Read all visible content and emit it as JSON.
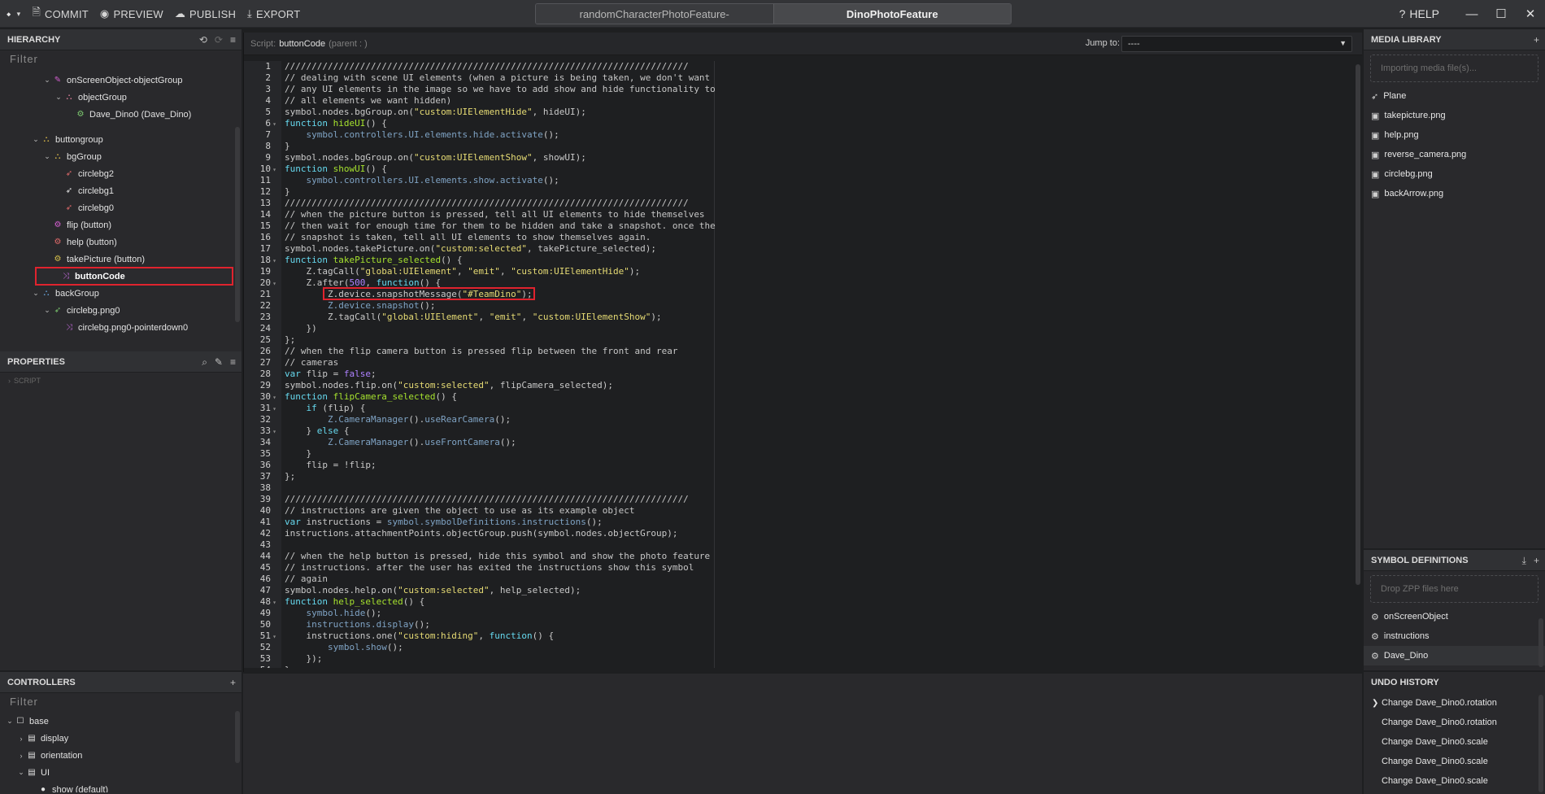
{
  "topbar": {
    "commit": "COMMIT",
    "preview": "PREVIEW",
    "publish": "PUBLISH",
    "export": "EXPORT",
    "help": "HELP",
    "tabs": [
      "randomCharacterPhotoFeature-",
      "DinoPhotoFeature"
    ],
    "active_tab_index": 1
  },
  "hierarchy": {
    "title": "HIERARCHY",
    "filter_placeholder": "Filter",
    "rows": [
      {
        "label": "onScreenObject-objectGroup",
        "level": 2,
        "caret": "open",
        "icon": "link",
        "color": "#d45fd0"
      },
      {
        "label": "objectGroup",
        "level": 3,
        "caret": "open",
        "icon": "group",
        "color": "#e2809e"
      },
      {
        "label": "Dave_Dino0 (Dave_Dino)",
        "level": 4,
        "caret": "",
        "icon": "gear",
        "color": "#7cc86f"
      },
      {
        "label": "",
        "level": 0,
        "caret": "",
        "icon": "",
        "color": ""
      },
      {
        "label": "buttongroup",
        "level": 1,
        "caret": "open",
        "icon": "group",
        "color": "#e3c14c"
      },
      {
        "label": "bgGroup",
        "level": 2,
        "caret": "open",
        "icon": "group",
        "color": "#e3c14c"
      },
      {
        "label": "circlebg2",
        "level": 3,
        "caret": "",
        "icon": "rocket",
        "color": "#e06a6a"
      },
      {
        "label": "circlebg1",
        "level": 3,
        "caret": "",
        "icon": "rocket",
        "color": "#e6e6e6"
      },
      {
        "label": "circlebg0",
        "level": 3,
        "caret": "",
        "icon": "rocket",
        "color": "#e06a6a"
      },
      {
        "label": "flip (button)",
        "level": 2,
        "caret": "",
        "icon": "gear",
        "color": "#d45fd0"
      },
      {
        "label": "help (button)",
        "level": 2,
        "caret": "",
        "icon": "gear",
        "color": "#e06a6a"
      },
      {
        "label": "takePicture (button)",
        "level": 2,
        "caret": "",
        "icon": "gear",
        "color": "#d7c04a"
      },
      {
        "label": "buttonCode",
        "level": 2,
        "caret": "",
        "icon": "script",
        "color": "#c06ad8",
        "selected": true
      },
      {
        "label": "backGroup",
        "level": 1,
        "caret": "open",
        "icon": "group",
        "color": "#6aa8e0"
      },
      {
        "label": "circlebg.png0",
        "level": 2,
        "caret": "open",
        "icon": "rocket",
        "color": "#7cc86f"
      },
      {
        "label": "circlebg.png0-pointerdown0",
        "level": 3,
        "caret": "",
        "icon": "script",
        "color": "#c06ad8"
      }
    ]
  },
  "properties": {
    "title": "PROPERTIES",
    "section": "SCRIPT"
  },
  "controllers": {
    "title": "CONTROLLERS",
    "filter_placeholder": "Filter",
    "rows": [
      {
        "label": "base",
        "level": 0,
        "caret": "open",
        "icon": "square"
      },
      {
        "label": "display",
        "level": 1,
        "caret": "closed",
        "icon": "list"
      },
      {
        "label": "orientation",
        "level": 1,
        "caret": "closed",
        "icon": "list"
      },
      {
        "label": "UI",
        "level": 1,
        "caret": "open",
        "icon": "list"
      },
      {
        "label": "show (default)",
        "level": 2,
        "caret": "",
        "icon": "dot"
      }
    ]
  },
  "editor": {
    "script_label": "Script:",
    "script_name": "buttonCode",
    "script_parent": "(parent : )",
    "jump_label": "Jump to:",
    "jump_value": "----",
    "lines": [
      [
        [
          "c",
          "///////////////////////////////////////////////////////////////////////////"
        ]
      ],
      [
        [
          "c",
          "// dealing with scene UI elements (when a picture is being taken, we don't want"
        ]
      ],
      [
        [
          "c",
          "// any UI elements in the image so we have to add show and hide functionality to"
        ]
      ],
      [
        [
          "c",
          "// all elements we want hidden)"
        ]
      ],
      [
        [
          "t",
          "symbol.nodes.bgGroup.on("
        ],
        [
          "s",
          "\"custom:UIElementHide\""
        ],
        [
          "t",
          ", hideUI);"
        ]
      ],
      [
        [
          "k",
          "function"
        ],
        [
          "t",
          " "
        ],
        [
          "f",
          "hideUI"
        ],
        [
          "t",
          "() {"
        ]
      ],
      [
        [
          "t",
          "    "
        ],
        [
          "d",
          "symbol.controllers.UI.elements.hide.activate"
        ],
        [
          "t",
          "();"
        ]
      ],
      [
        [
          "t",
          "}"
        ]
      ],
      [
        [
          "t",
          "symbol.nodes.bgGroup.on("
        ],
        [
          "s",
          "\"custom:UIElementShow\""
        ],
        [
          "t",
          ", showUI);"
        ]
      ],
      [
        [
          "k",
          "function"
        ],
        [
          "t",
          " "
        ],
        [
          "f",
          "showUI"
        ],
        [
          "t",
          "() {"
        ]
      ],
      [
        [
          "t",
          "    "
        ],
        [
          "d",
          "symbol.controllers.UI.elements.show.activate"
        ],
        [
          "t",
          "();"
        ]
      ],
      [
        [
          "t",
          "}"
        ]
      ],
      [
        [
          "c",
          "///////////////////////////////////////////////////////////////////////////"
        ]
      ],
      [
        [
          "c",
          "// when the picture button is pressed, tell all UI elements to hide themselves"
        ]
      ],
      [
        [
          "c",
          "// then wait for enough time for them to be hidden and take a snapshot. once the"
        ]
      ],
      [
        [
          "c",
          "// snapshot is taken, tell all UI elements to show themselves again."
        ]
      ],
      [
        [
          "t",
          "symbol.nodes.takePicture.on("
        ],
        [
          "s",
          "\"custom:selected\""
        ],
        [
          "t",
          ", takePicture_selected);"
        ]
      ],
      [
        [
          "k",
          "function"
        ],
        [
          "t",
          " "
        ],
        [
          "f",
          "takePicture_selected"
        ],
        [
          "t",
          "() {"
        ]
      ],
      [
        [
          "t",
          "    Z.tagCall("
        ],
        [
          "s",
          "\"global:UIElement\""
        ],
        [
          "t",
          ", "
        ],
        [
          "s",
          "\"emit\""
        ],
        [
          "t",
          ", "
        ],
        [
          "s",
          "\"custom:UIElementHide\""
        ],
        [
          "t",
          ");"
        ]
      ],
      [
        [
          "t",
          "    Z.after("
        ],
        [
          "n",
          "500"
        ],
        [
          "t",
          ", "
        ],
        [
          "k",
          "function"
        ],
        [
          "t",
          "() {"
        ]
      ],
      [
        [
          "t",
          "        Z.device.snapshotMessage("
        ],
        [
          "s",
          "\"#TeamDino\""
        ],
        [
          "t",
          ");"
        ]
      ],
      [
        [
          "t",
          "        "
        ],
        [
          "d",
          "Z.device.snapshot"
        ],
        [
          "t",
          "();"
        ]
      ],
      [
        [
          "t",
          "        Z.tagCall("
        ],
        [
          "s",
          "\"global:UIElement\""
        ],
        [
          "t",
          ", "
        ],
        [
          "s",
          "\"emit\""
        ],
        [
          "t",
          ", "
        ],
        [
          "s",
          "\"custom:UIElementShow\""
        ],
        [
          "t",
          ");"
        ]
      ],
      [
        [
          "t",
          "    })"
        ]
      ],
      [
        [
          "t",
          "};"
        ]
      ],
      [
        [
          "c",
          "// when the flip camera button is pressed flip between the front and rear"
        ]
      ],
      [
        [
          "c",
          "// cameras"
        ]
      ],
      [
        [
          "k",
          "var"
        ],
        [
          "t",
          " flip = "
        ],
        [
          "n",
          "false"
        ],
        [
          "t",
          ";"
        ]
      ],
      [
        [
          "t",
          "symbol.nodes.flip.on("
        ],
        [
          "s",
          "\"custom:selected\""
        ],
        [
          "t",
          ", flipCamera_selected);"
        ]
      ],
      [
        [
          "k",
          "function"
        ],
        [
          "t",
          " "
        ],
        [
          "f",
          "flipCamera_selected"
        ],
        [
          "t",
          "() {"
        ]
      ],
      [
        [
          "t",
          "    "
        ],
        [
          "k",
          "if"
        ],
        [
          "t",
          " (flip) {"
        ]
      ],
      [
        [
          "t",
          "        "
        ],
        [
          "d",
          "Z.CameraManager"
        ],
        [
          "t",
          "()."
        ],
        [
          "d",
          "useRearCamera"
        ],
        [
          "t",
          "();"
        ]
      ],
      [
        [
          "t",
          "    } "
        ],
        [
          "k",
          "else"
        ],
        [
          "t",
          " {"
        ]
      ],
      [
        [
          "t",
          "        "
        ],
        [
          "d",
          "Z.CameraManager"
        ],
        [
          "t",
          "()."
        ],
        [
          "d",
          "useFrontCamera"
        ],
        [
          "t",
          "();"
        ]
      ],
      [
        [
          "t",
          "    }"
        ]
      ],
      [
        [
          "t",
          "    flip = !flip;"
        ]
      ],
      [
        [
          "t",
          "};"
        ]
      ],
      [
        [
          "t",
          ""
        ]
      ],
      [
        [
          "c",
          "///////////////////////////////////////////////////////////////////////////"
        ]
      ],
      [
        [
          "c",
          "// instructions are given the object to use as its example object"
        ]
      ],
      [
        [
          "k",
          "var"
        ],
        [
          "t",
          " instructions = "
        ],
        [
          "d",
          "symbol.symbolDefinitions.instructions"
        ],
        [
          "t",
          "();"
        ]
      ],
      [
        [
          "t",
          "instructions.attachmentPoints.objectGroup.push(symbol.nodes.objectGroup);"
        ]
      ],
      [
        [
          "t",
          ""
        ]
      ],
      [
        [
          "c",
          "// when the help button is pressed, hide this symbol and show the photo feature"
        ]
      ],
      [
        [
          "c",
          "// instructions. after the user has exited the instructions show this symbol"
        ]
      ],
      [
        [
          "c",
          "// again"
        ]
      ],
      [
        [
          "t",
          "symbol.nodes.help.on("
        ],
        [
          "s",
          "\"custom:selected\""
        ],
        [
          "t",
          ", help_selected);"
        ]
      ],
      [
        [
          "k",
          "function"
        ],
        [
          "t",
          " "
        ],
        [
          "f",
          "help_selected"
        ],
        [
          "t",
          "() {"
        ]
      ],
      [
        [
          "t",
          "    "
        ],
        [
          "d",
          "symbol.hide"
        ],
        [
          "t",
          "();"
        ]
      ],
      [
        [
          "t",
          "    "
        ],
        [
          "d",
          "instructions.display"
        ],
        [
          "t",
          "();"
        ]
      ],
      [
        [
          "t",
          "    instructions.one("
        ],
        [
          "s",
          "\"custom:hiding\""
        ],
        [
          "t",
          ", "
        ],
        [
          "k",
          "function"
        ],
        [
          "t",
          "() {"
        ]
      ],
      [
        [
          "t",
          "        "
        ],
        [
          "d",
          "symbol.show"
        ],
        [
          "t",
          "();"
        ]
      ],
      [
        [
          "t",
          "    });"
        ]
      ],
      [
        [
          "t",
          "};"
        ]
      ]
    ],
    "fold_lines": [
      6,
      10,
      18,
      20,
      30,
      31,
      33,
      48,
      51
    ]
  },
  "media_library": {
    "title": "MEDIA LIBRARY",
    "dropzone": "Importing media file(s)...",
    "items": [
      {
        "label": "Plane",
        "icon": "rocket"
      },
      {
        "label": "takepicture.png",
        "icon": "image"
      },
      {
        "label": "help.png",
        "icon": "image"
      },
      {
        "label": "reverse_camera.png",
        "icon": "image"
      },
      {
        "label": "circlebg.png",
        "icon": "image"
      },
      {
        "label": "backArrow.png",
        "icon": "image"
      }
    ]
  },
  "symbol_definitions": {
    "title": "SYMBOL DEFINITIONS",
    "dropzone": "Drop ZPP files here",
    "items": [
      "onScreenObject",
      "instructions",
      "Dave_Dino"
    ]
  },
  "undo_history": {
    "title": "UNDO HISTORY",
    "items": [
      "Change Dave_Dino0.rotation",
      "Change Dave_Dino0.rotation",
      "Change Dave_Dino0.scale",
      "Change Dave_Dino0.scale",
      "Change Dave_Dino0.scale"
    ]
  }
}
